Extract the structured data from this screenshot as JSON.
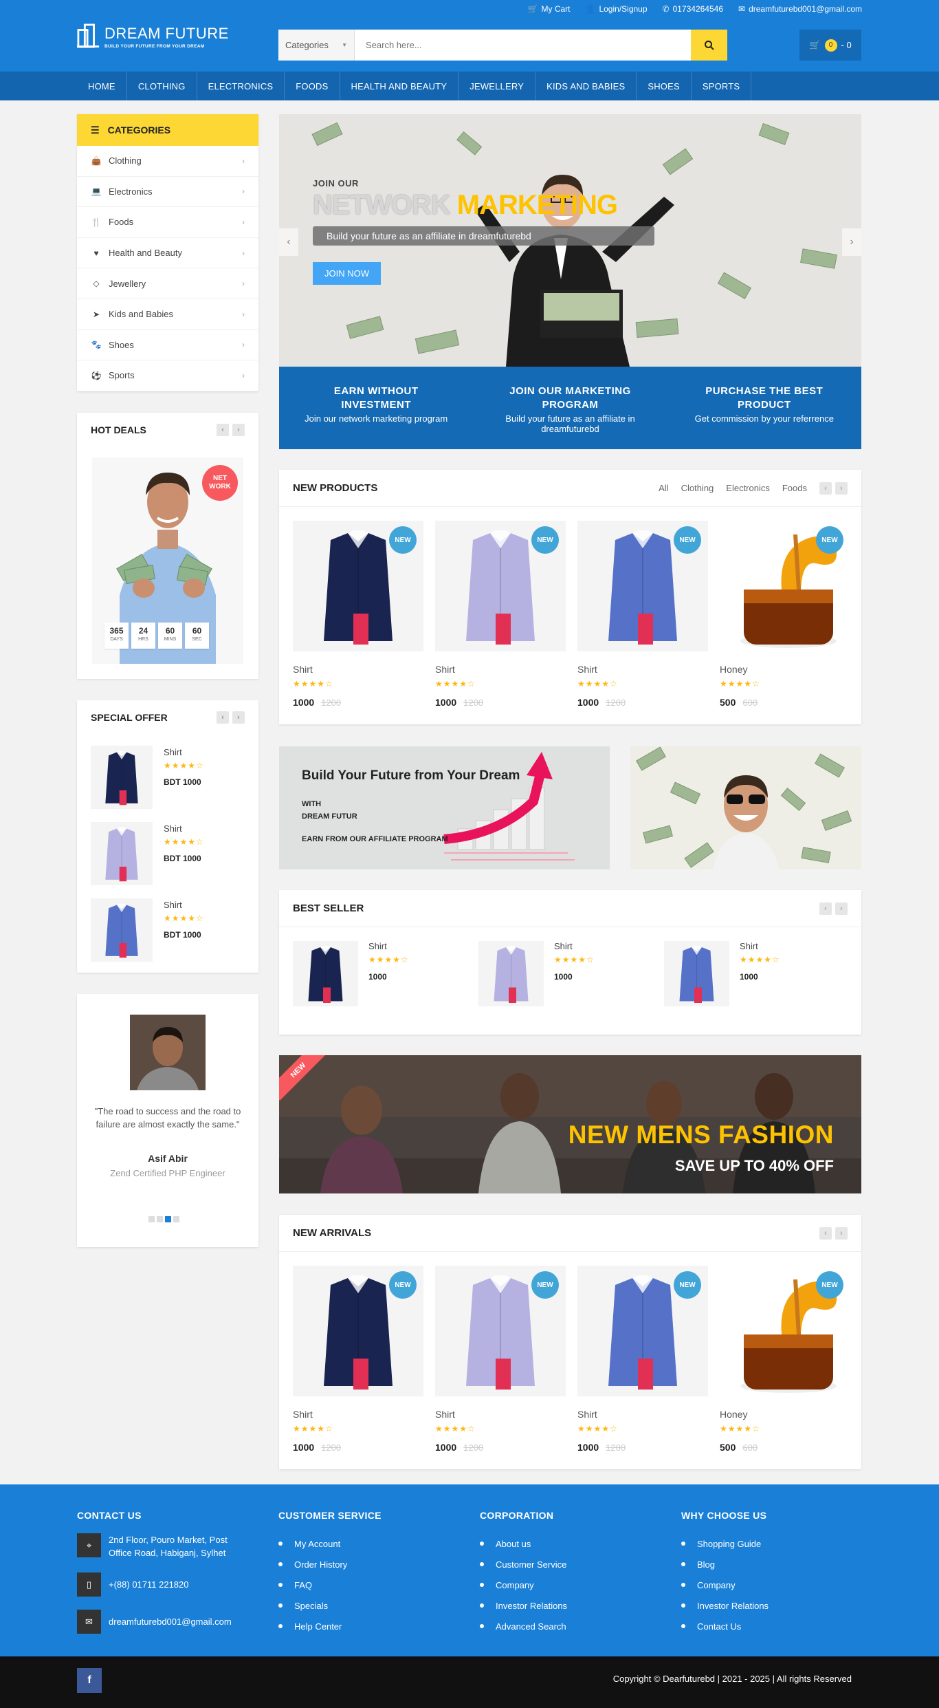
{
  "topbar": {
    "cart": "My Cart",
    "login": "Login/Signup",
    "phone": "01734264546",
    "email": "dreamfuturebd001@gmail.com"
  },
  "brand": {
    "name": "DREAM FUTURE",
    "tagline": "BUILD YOUR FUTURE FROM YOUR DREAM"
  },
  "search": {
    "category": "Categories",
    "placeholder": "Search here..."
  },
  "cart": {
    "count": "0",
    "total": "- 0"
  },
  "nav": [
    "HOME",
    "CLOTHING",
    "ELECTRONICS",
    "FOODS",
    "HEALTH AND BEAUTY",
    "JEWELLERY",
    "KIDS AND BABIES",
    "SHOES",
    "SPORTS"
  ],
  "categories": {
    "title": "CATEGORIES",
    "items": [
      {
        "label": "Clothing",
        "icon": "shopping-bag-icon"
      },
      {
        "label": "Electronics",
        "icon": "laptop-icon"
      },
      {
        "label": "Foods",
        "icon": "cutlery-icon"
      },
      {
        "label": "Health and Beauty",
        "icon": "heartbeat-icon"
      },
      {
        "label": "Jewellery",
        "icon": "diamond-icon"
      },
      {
        "label": "Kids and Babies",
        "icon": "paper-plane-icon"
      },
      {
        "label": "Shoes",
        "icon": "paw-icon"
      },
      {
        "label": "Sports",
        "icon": "soccer-ball-icon"
      }
    ]
  },
  "hot_deals": {
    "title": "HOT DEALS",
    "badge": "NET WORK",
    "countdown": [
      {
        "v": "365",
        "u": "DAYS"
      },
      {
        "v": "24",
        "u": "HRS"
      },
      {
        "v": "60",
        "u": "MINS"
      },
      {
        "v": "60",
        "u": "SEC"
      }
    ]
  },
  "special_offer": {
    "title": "SPECIAL OFFER",
    "items": [
      {
        "name": "Shirt",
        "price": "BDT 1000"
      },
      {
        "name": "Shirt",
        "price": "BDT 1000"
      },
      {
        "name": "Shirt",
        "price": "BDT 1000"
      }
    ]
  },
  "testimonial": {
    "quote": "\"The road to success and the road to failure are almost exactly the same.\"",
    "name": "Asif Abir",
    "role": "Zend Certified PHP Engineer"
  },
  "hero": {
    "pre": "JOIN OUR",
    "title_a": "NETWORK ",
    "title_b": "MARKETING",
    "subtitle": "Build your future as an affiliate in dreamfuturebd",
    "button": "JOIN NOW"
  },
  "strip": [
    {
      "title": "EARN WITHOUT INVESTMENT",
      "text": "Join our network marketing program"
    },
    {
      "title": "JOIN OUR MARKETING PROGRAM",
      "text": "Build your future as an affiliate in dreamfuturebd"
    },
    {
      "title": "PURCHASE THE BEST PRODUCT",
      "text": "Get commission by your referrence"
    }
  ],
  "new_products": {
    "title": "NEW PRODUCTS",
    "tabs": [
      "All",
      "Clothing",
      "Electronics",
      "Foods"
    ],
    "items": [
      {
        "name": "Shirt",
        "price": "1000",
        "old": "1200",
        "badge": "NEW",
        "rating": 4
      },
      {
        "name": "Shirt",
        "price": "1000",
        "old": "1200",
        "badge": "NEW",
        "rating": 4
      },
      {
        "name": "Shirt",
        "price": "1000",
        "old": "1200",
        "badge": "NEW",
        "rating": 4
      },
      {
        "name": "Honey",
        "price": "500",
        "old": "600",
        "badge": "NEW",
        "rating": 4
      }
    ]
  },
  "banner1": {
    "title": "Build Your Future from Your Dream",
    "line1": "WITH",
    "line2": "DREAM FUTUR",
    "line3": "EARN FROM OUR AFFILIATE PROGRAM"
  },
  "best_seller": {
    "title": "BEST SELLER",
    "items": [
      {
        "name": "Shirt",
        "price": "1000"
      },
      {
        "name": "Shirt",
        "price": "1000"
      },
      {
        "name": "Shirt",
        "price": "1000"
      }
    ]
  },
  "fashion": {
    "ribbon": "NEW",
    "title": "NEW MENS FASHION",
    "subtitle": "SAVE UP TO 40% OFF"
  },
  "new_arrivals": {
    "title": "NEW ARRIVALS",
    "items": [
      {
        "name": "Shirt",
        "price": "1000",
        "old": "1200",
        "badge": "NEW",
        "rating": 4
      },
      {
        "name": "Shirt",
        "price": "1000",
        "old": "1200",
        "badge": "NEW",
        "rating": 4
      },
      {
        "name": "Shirt",
        "price": "1000",
        "old": "1200",
        "badge": "NEW",
        "rating": 4
      },
      {
        "name": "Honey",
        "price": "500",
        "old": "600",
        "badge": "NEW",
        "rating": 4
      }
    ]
  },
  "footer": {
    "contact": {
      "title": "CONTACT US",
      "address": "2nd Floor, Pouro Market, Post Office Road, Habiganj, Sylhet",
      "phone": "+(88) 01711 221820",
      "email": "dreamfuturebd001@gmail.com"
    },
    "customer_service": {
      "title": "CUSTOMER SERVICE",
      "links": [
        "My Account",
        "Order History",
        "FAQ",
        "Specials",
        "Help Center"
      ]
    },
    "corporation": {
      "title": "CORPORATION",
      "links": [
        "About us",
        "Customer Service",
        "Company",
        "Investor Relations",
        "Advanced Search"
      ]
    },
    "why": {
      "title": "WHY CHOOSE US",
      "links": [
        "Shopping Guide",
        "Blog",
        "Company",
        "Investor Relations",
        "Contact Us"
      ]
    },
    "copyright": "Copyright © Dearfuturebd | 2021 - 2025 | All rights Reserved"
  },
  "colors": {
    "primary": "#1a7fd6",
    "dark_blue": "#146ab4",
    "accent": "#fdd835",
    "badge": "#42a5d8",
    "sale": "#f8595e"
  }
}
